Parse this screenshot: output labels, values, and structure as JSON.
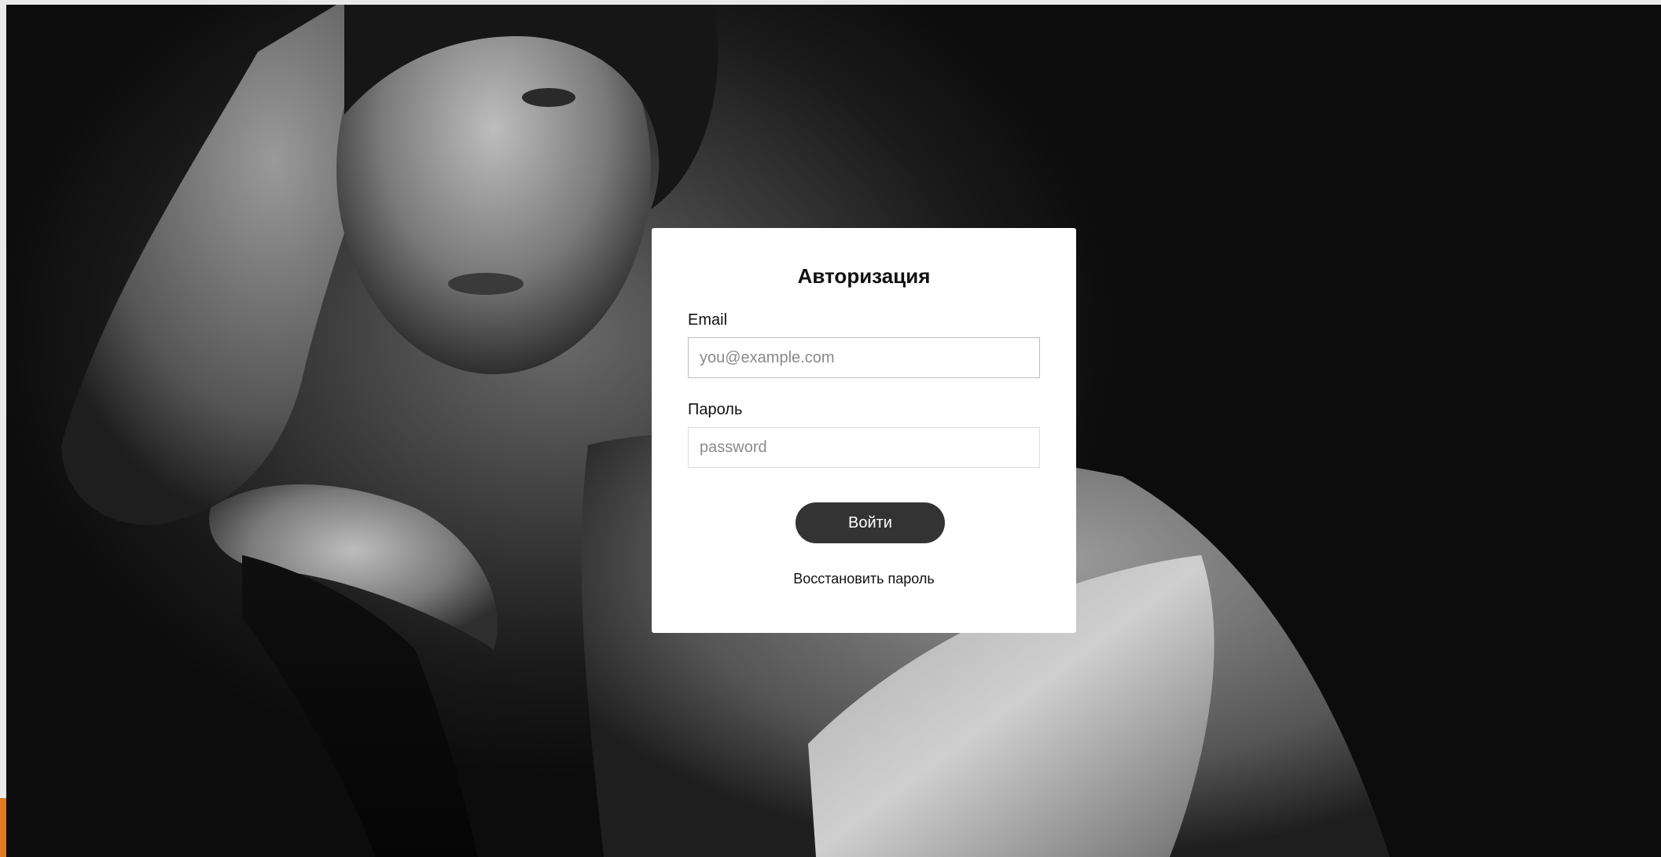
{
  "login_form": {
    "title": "Авторизация",
    "email_label": "Email",
    "email_placeholder": "you@example.com",
    "password_label": "Пароль",
    "password_placeholder": "password",
    "submit_label": "Войти",
    "restore_label": "Восстановить пароль"
  },
  "background": {
    "icon": "portrait-photo-image",
    "tone": "black-and-white"
  },
  "colors": {
    "button": "#333333",
    "card": "#ffffff",
    "frame_accent": "#e07b1f"
  }
}
